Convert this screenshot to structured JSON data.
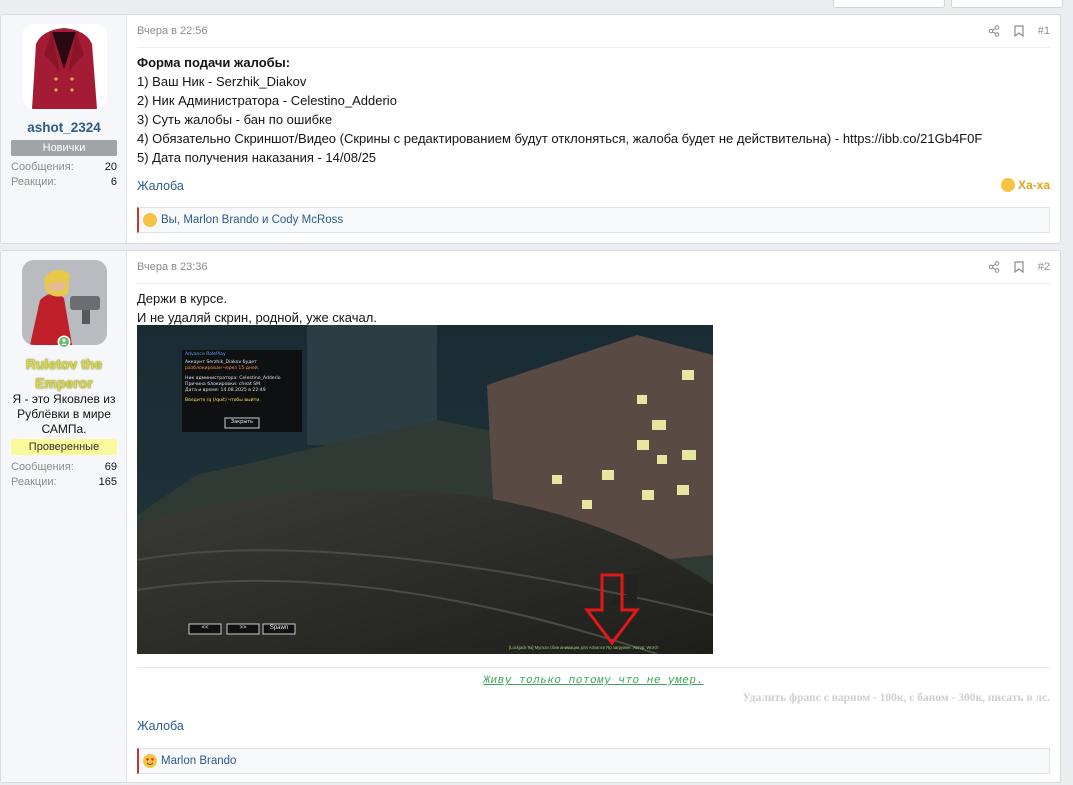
{
  "posts": [
    {
      "user": {
        "name": "ashot_2324",
        "banner": "Новички",
        "stats": [
          {
            "k": "Сообщения:",
            "v": "20"
          },
          {
            "k": "Реакции:",
            "v": "6"
          }
        ]
      },
      "time": "Вчера в 22:56",
      "num": "#1",
      "lines": [
        "Форма подачи жалобы:",
        "1) Ваш Ник - Serzhik_Diakov",
        "2) Ник Администратора - Celestino_Adderio",
        "3) Суть жалобы - бан по ошибке",
        "4) Обязательно Скриншот/Видео (Скрины с редактированием будут отклоняться, жалоба будет не действительна) - https://ibb.co/21Gb4F0F",
        "5) Дата получения наказания - 14/08/25"
      ],
      "tag": "Жалоба",
      "reaction_label": "Ха-ха",
      "reacted": "Вы, Marlon Brando и Cody McRoss"
    },
    {
      "user": {
        "name": "Ruletov the Emperor",
        "title": "Я - это Яковлев из Рублёвки в мире САМПа.",
        "banner": "Проверенные",
        "stats": [
          {
            "k": "Сообщения:",
            "v": "69"
          },
          {
            "k": "Реакции:",
            "v": "165"
          }
        ]
      },
      "time": "Вчера в 23:36",
      "num": "#2",
      "lines": [
        "Держи в курсе.",
        "И не удаляй скрин, родной, уже скачал."
      ],
      "screenshot": {
        "dialog_title": "Advance RolePlay",
        "dialog_lines": [
          "Аккаунт Serzhik_Diakov будет",
          "разблокирован через 15 дней.",
          "",
          "Ник администратора: Celestino_Adderio",
          "Причина блокировки: cheat SM",
          "Дата и время: 14.08.2025 в 22:49",
          "",
          "Введите /q (/quit) чтобы выйти."
        ],
        "dialog_button": "Закрыть",
        "nav": [
          "<<",
          ">>",
          "Spawn"
        ],
        "footer": "[Lockjack 9a] Мульти сбив анимации для Advance Rp загружен. Автор: Worch"
      },
      "signature1": "Живу только потому что не умер.",
      "signature2": "Удалить фрапс с варном - 100к, с баном - 300к, писать в лс.",
      "tag": "Жалоба",
      "reacted": "Marlon Brando"
    }
  ],
  "colors": {
    "link": "#2b5c8a",
    "username1": "#2b5c8a",
    "username2": "#d8d84a",
    "banner_new": "#a0a3a8",
    "banner_verified": "#fafa9c",
    "reaction": "#e0a31a"
  }
}
